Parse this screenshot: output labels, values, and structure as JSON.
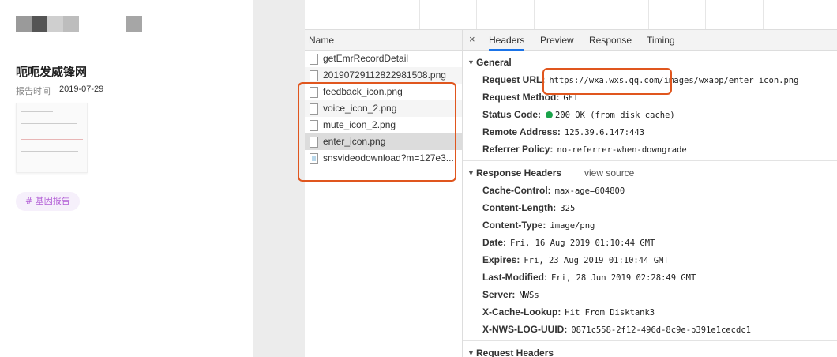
{
  "left_page": {
    "title": "呃呃发威锋网",
    "report_label": "报告时间",
    "report_date": "2019-07-29",
    "tag": "# 基因报告",
    "tag_color": "#b35fd6"
  },
  "network": {
    "name_header": "Name",
    "requests": [
      {
        "name": "getEmrRecordDetail",
        "icon": "file-icon"
      },
      {
        "name": "20190729112822981508.png",
        "icon": "file-icon"
      },
      {
        "name": "feedback_icon.png",
        "icon": "file-icon"
      },
      {
        "name": "voice_icon_2.png",
        "icon": "file-icon"
      },
      {
        "name": "mute_icon_2.png",
        "icon": "file-icon"
      },
      {
        "name": "enter_icon.png",
        "icon": "file-icon",
        "selected": true
      },
      {
        "name": "snsvideodownload?m=127e3...",
        "icon": "image-file-icon"
      }
    ]
  },
  "details": {
    "close": "×",
    "tabs": [
      "Headers",
      "Preview",
      "Response",
      "Timing"
    ],
    "active_tab": "Headers",
    "general": {
      "title": "General",
      "rows": [
        {
          "key": "Request URL:",
          "value": "https://wxa.wxs.qq.com/images/wxapp/enter_icon.png"
        },
        {
          "key": "Request Method:",
          "value": "GET"
        },
        {
          "key": "Status Code:",
          "value": "200 OK (from disk cache)"
        },
        {
          "key": "Remote Address:",
          "value": "125.39.6.147:443"
        },
        {
          "key": "Referrer Policy:",
          "value": "no-referrer-when-downgrade"
        }
      ]
    },
    "response_headers": {
      "title": "Response Headers",
      "view_source": "view source",
      "rows": [
        {
          "key": "Cache-Control:",
          "value": "max-age=604800"
        },
        {
          "key": "Content-Length:",
          "value": "325"
        },
        {
          "key": "Content-Type:",
          "value": "image/png"
        },
        {
          "key": "Date:",
          "value": "Fri, 16 Aug 2019 01:10:44 GMT"
        },
        {
          "key": "Expires:",
          "value": "Fri, 23 Aug 2019 01:10:44 GMT"
        },
        {
          "key": "Last-Modified:",
          "value": "Fri, 28 Jun 2019 02:28:49 GMT"
        },
        {
          "key": "Server:",
          "value": "NWSs"
        },
        {
          "key": "X-Cache-Lookup:",
          "value": "Hit From Disktank3"
        },
        {
          "key": "X-NWS-LOG-UUID:",
          "value": "0871c558-2f12-496d-8c9e-b391e1cecdc1"
        }
      ]
    },
    "request_headers": {
      "title": "Request Headers"
    },
    "status_color": "#1aa34a",
    "highlight_color": "#e0561e"
  }
}
